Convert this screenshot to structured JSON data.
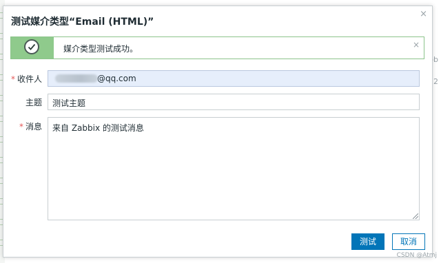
{
  "dialog": {
    "title": "测试媒介类型“Email (HTML)”",
    "close_icon": "×"
  },
  "message": {
    "text": "媒介类型测试成功。",
    "icon": "check-circle-icon",
    "close_icon": "×",
    "colors": {
      "icon_bg": "#8fca8c",
      "border": "#8bc38a"
    }
  },
  "form": {
    "recipient": {
      "label": "收件人",
      "required_mark": "*",
      "value_visible": "@qq.com"
    },
    "subject": {
      "label": "主题",
      "value": "测试主题"
    },
    "message": {
      "label": "消息",
      "required_mark": "*",
      "value": "来自 Zabbix 的测试消息"
    }
  },
  "buttons": {
    "test_label": "测试",
    "cancel_label": "取消"
  },
  "background": {
    "right_fragment_1": "bb",
    "right_fragment_2": "12"
  },
  "watermark": "CSDN @Atmj",
  "colors": {
    "primary": "#0275b8",
    "required": "#e45959"
  }
}
